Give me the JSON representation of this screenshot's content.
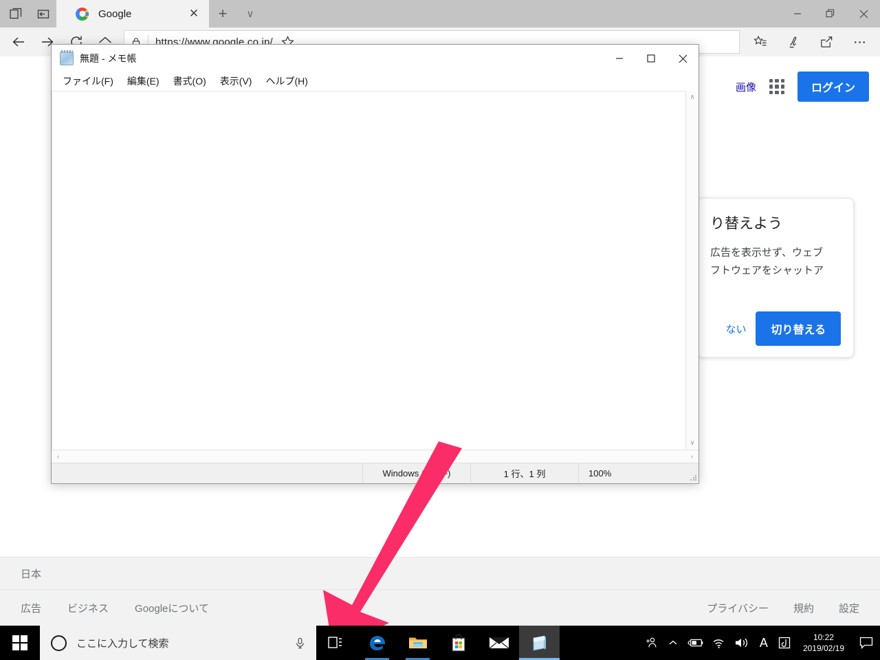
{
  "browser": {
    "tab": {
      "title": "Google",
      "favicon": "google-favicon",
      "close_label": "✕"
    },
    "new_tab_label": "+",
    "tab_dropdown_label": "∨",
    "window_controls": {
      "minimize": "—",
      "restore": "❐",
      "close": "✕"
    },
    "address": {
      "url": "https://www.google.co.jp/",
      "lock_icon": "lock-icon"
    },
    "toolbar_icons": [
      "back-icon",
      "forward-icon",
      "refresh-icon",
      "home-icon",
      "favorite-star-icon",
      "favorites-hub-icon",
      "web-notes-icon",
      "share-icon",
      "settings-more-icon"
    ]
  },
  "google": {
    "nav": {
      "images_label": "画像",
      "apps_icon": "apps-grid-icon",
      "signin_label": "ログイン"
    },
    "promo": {
      "heading": "り替えよう",
      "line1": "広告を表示せず、ウェブ",
      "line2": "フトウェアをシャットア",
      "decline_label": "ない",
      "accept_label": "切り替える"
    },
    "footer": {
      "country": "日本",
      "left_links": [
        "広告",
        "ビジネス",
        "Googleについて"
      ],
      "right_links": [
        "プライバシー",
        "規約",
        "設定"
      ]
    }
  },
  "notepad": {
    "title": "無題 - メモ帳",
    "icon": "notepad-icon",
    "menus": [
      "ファイル(F)",
      "編集(E)",
      "書式(O)",
      "表示(V)",
      "ヘルプ(H)"
    ],
    "window_controls": {
      "minimize": "—",
      "maximize": "□",
      "close": "✕"
    },
    "text_content": "",
    "status": {
      "line_ending": "Windows (CRLF)",
      "cursor": "1 行、1 列",
      "zoom": "100%"
    },
    "scroll": {
      "up": "∧",
      "down": "∨",
      "left": "‹",
      "right": "›"
    }
  },
  "annotation": {
    "arrow_color": "#FA2D68",
    "points_to": "task-view-button"
  },
  "taskbar": {
    "start_icon": "windows-start-icon",
    "search_placeholder": "ここに入力して検索",
    "cortana_icon": "cortana-circle-icon",
    "mic_icon": "microphone-icon",
    "apps": [
      {
        "name": "task-view-button",
        "icon": "task-view-icon",
        "state": "idle"
      },
      {
        "name": "edge-button",
        "icon": "edge-icon",
        "state": "open"
      },
      {
        "name": "file-explorer-button",
        "icon": "folder-icon",
        "state": "open"
      },
      {
        "name": "microsoft-store-button",
        "icon": "store-bag-icon",
        "state": "idle"
      },
      {
        "name": "mail-button",
        "icon": "envelope-icon",
        "state": "idle"
      },
      {
        "name": "notepad-button",
        "icon": "notepad-icon",
        "state": "active"
      }
    ],
    "tray": {
      "people_icon": "people-icon",
      "chevron_icon": "show-hidden-icons-chevron",
      "battery_icon": "battery-charging-icon",
      "network_icon": "wifi-icon",
      "volume_icon": "speaker-icon",
      "ime_mode": "A",
      "ime_tool_icon": "ime-tool-icon",
      "time": "10:22",
      "date": "2019/02/19",
      "action_center_icon": "action-center-icon"
    }
  }
}
